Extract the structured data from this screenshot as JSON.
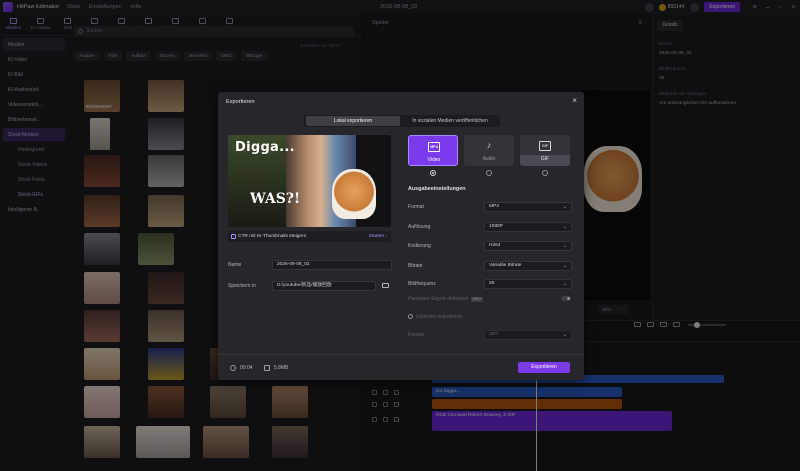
{
  "app": {
    "name": "HitPaw Edimakor",
    "menu": [
      "Datei",
      "Einstellungen",
      "Hilfe"
    ],
    "doc_title": "2026-08-08_02",
    "credits": "893144",
    "export_label": "Exportieren"
  },
  "toolbar": [
    {
      "label": "Medien",
      "icon": "media-icon"
    },
    {
      "label": "KI-Avatar",
      "icon": "avatar-icon"
    },
    {
      "label": "Text",
      "icon": "text-icon"
    },
    {
      "label": "Untertitel",
      "icon": "subtitle-icon"
    },
    {
      "label": "Audio",
      "icon": "audio-icon"
    },
    {
      "label": "Elemente",
      "icon": "elements-icon"
    },
    {
      "label": "Übergang",
      "icon": "transition-icon"
    },
    {
      "label": "Filter",
      "icon": "filter-icon"
    },
    {
      "label": "Effekte",
      "icon": "effects-icon"
    }
  ],
  "sidebar": {
    "items": [
      "Medien",
      "KI-Video",
      "KI-Bild",
      "KI-Audiostück",
      "Videoverstärk...",
      "Bildverbesse...",
      "Stock-Medien"
    ],
    "sub_items": [
      "Hintergrund",
      "Stock-Videos",
      "Stock-Fotos",
      "Stock-GIFs"
    ],
    "last": "Intelligente B..."
  },
  "search": {
    "placeholder": "Suchen",
    "hint": "unterstützt von GIPHY"
  },
  "chips": [
    "Avatare",
    "Film",
    "Aufblut",
    "Tanzen",
    "Mimeshit",
    "OMG",
    "Witziger"
  ],
  "thumb_label": "BOOSHIGHT",
  "player": {
    "title": "Spieler",
    "zoom": "16:9"
  },
  "details": {
    "tab": "Details",
    "name_label": "Name",
    "name_value": "2026-08-08_02",
    "fps_label": "Bildfrequenz",
    "fps_value": "30",
    "fill_label": "Methode der Einfügen",
    "fill_value": "Am ursprünglichen Ort aufbewahren"
  },
  "timeline": {
    "clips": [
      {
        "label": "Da Digga...",
        "color": "#2b59c3"
      },
      {
        "label": "",
        "color": "#b45309"
      },
      {
        "label": "DCB Carnaval Robert Downey Jr GIF",
        "color": "#6d28d9"
      }
    ]
  },
  "modal": {
    "title": "Exportieren",
    "tabs": [
      "Lokal exportieren",
      "In sozialen Medien veröffentlichen"
    ],
    "preview_caption_top": "Digga...",
    "preview_caption_bottom": "WAS?!",
    "ctr_text": "CTR mit KI-Thumbnails steigern",
    "ctr_start": "Starten",
    "name_label": "Name",
    "name_value": "2026-09-08_02",
    "save_label": "Speichern in",
    "save_value": "D:/youtube/新品/播放回放",
    "formats": [
      {
        "label": "Video",
        "glyph": "MP4",
        "selected": true
      },
      {
        "label": "Audio",
        "glyph": "♪",
        "selected": false
      },
      {
        "label": "GIF",
        "glyph": "GIF",
        "selected": false
      }
    ],
    "section_title": "Ausgabeeinstellungen",
    "settings": [
      {
        "label": "Format",
        "value": "MP4"
      },
      {
        "label": "Auflösung",
        "value": "1080P"
      },
      {
        "label": "Kodierung",
        "value": "H264"
      },
      {
        "label": "Bitrate",
        "value": "Variable Bitrate"
      },
      {
        "label": "Bildfrequenz",
        "value": "25"
      }
    ],
    "gpu_label": "Hardware-Export aktivieren",
    "gpu_badge": "GPU",
    "subtitle_label": "Untertitel exportieren",
    "subtitle_format_label": "Format",
    "subtitle_format_value": "SRT",
    "duration": "00:04",
    "size": "5.8MB",
    "export_button": "Exportieren"
  }
}
